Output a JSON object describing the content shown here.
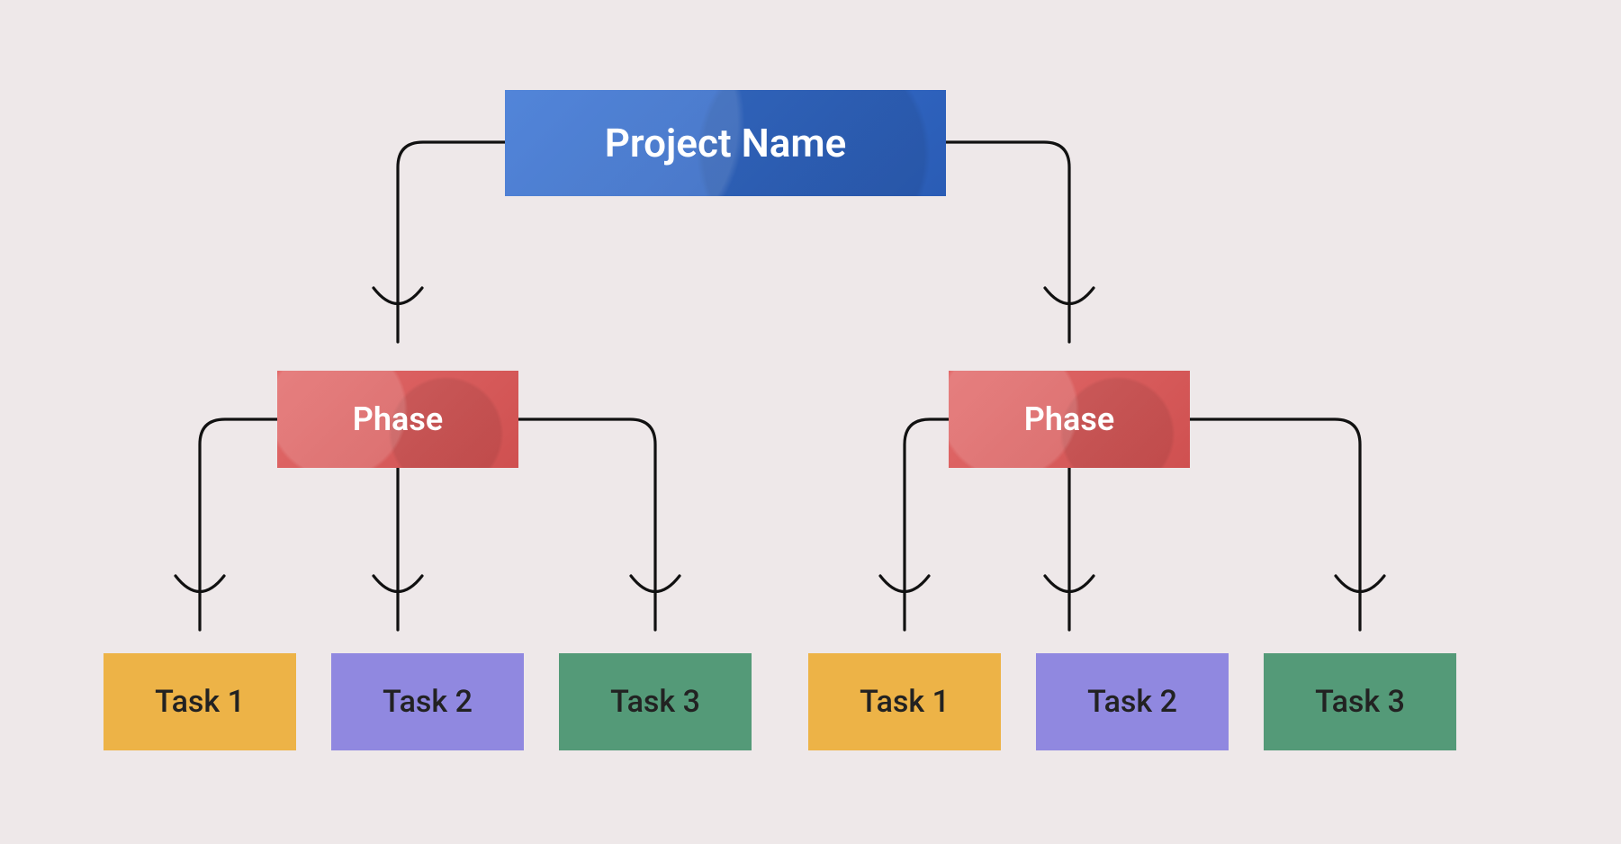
{
  "root": {
    "label": "Project Name",
    "color": "#2f66c2"
  },
  "phases": [
    {
      "label": "Phase",
      "color": "#db5c5c"
    },
    {
      "label": "Phase",
      "color": "#db5c5c"
    }
  ],
  "tasks_left": [
    {
      "label": "Task 1",
      "color": "#edb347"
    },
    {
      "label": "Task 2",
      "color": "#9088e0"
    },
    {
      "label": "Task 3",
      "color": "#549a78"
    }
  ],
  "tasks_right": [
    {
      "label": "Task 1",
      "color": "#edb347"
    },
    {
      "label": "Task 2",
      "color": "#9088e0"
    },
    {
      "label": "Task 3",
      "color": "#549a78"
    }
  ],
  "background": "#eee8e9"
}
